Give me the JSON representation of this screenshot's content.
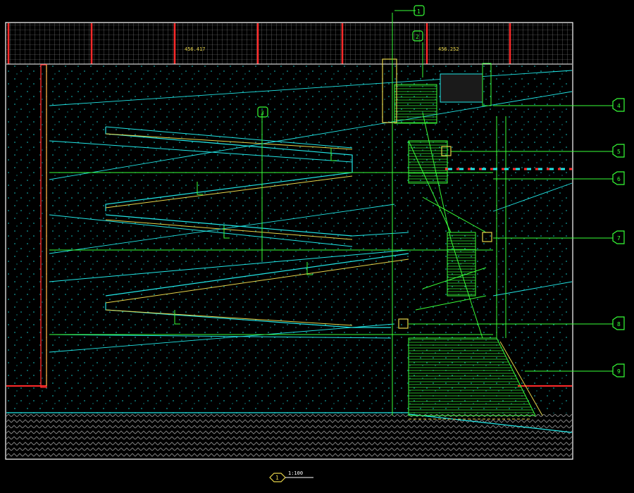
{
  "colors": {
    "background": "#000000",
    "frame": "#ffffff",
    "grid": "#8a8a8a",
    "wall_red": "#ff2a2a",
    "stair_green": "#39ff39",
    "leader_green": "#37ff37",
    "ramp_cyan": "#22e6e6",
    "ramp_yellow": "#e7d44a",
    "hatch_dots": "#16c9c9",
    "ground_hatch": "#7a7a7a"
  },
  "drawing": {
    "top_band_labels": [
      "456.417",
      "456.252"
    ],
    "callouts": [
      {
        "id": "top-stair",
        "symbol": "A",
        "label": "1"
      },
      {
        "id": "top-mid",
        "symbol": "B",
        "label": "2"
      },
      {
        "id": "left-mid",
        "symbol": "C",
        "label": "3"
      },
      {
        "id": "right-1",
        "symbol": "D",
        "label": "4"
      },
      {
        "id": "right-2",
        "symbol": "E",
        "label": "5"
      },
      {
        "id": "right-3",
        "symbol": "F",
        "label": "6"
      },
      {
        "id": "right-4",
        "symbol": "G",
        "label": "7"
      },
      {
        "id": "right-5",
        "symbol": "H",
        "label": "8"
      },
      {
        "id": "right-6",
        "symbol": "I",
        "label": "9"
      }
    ],
    "title_block": {
      "number": "1",
      "scale": "1:100"
    }
  }
}
